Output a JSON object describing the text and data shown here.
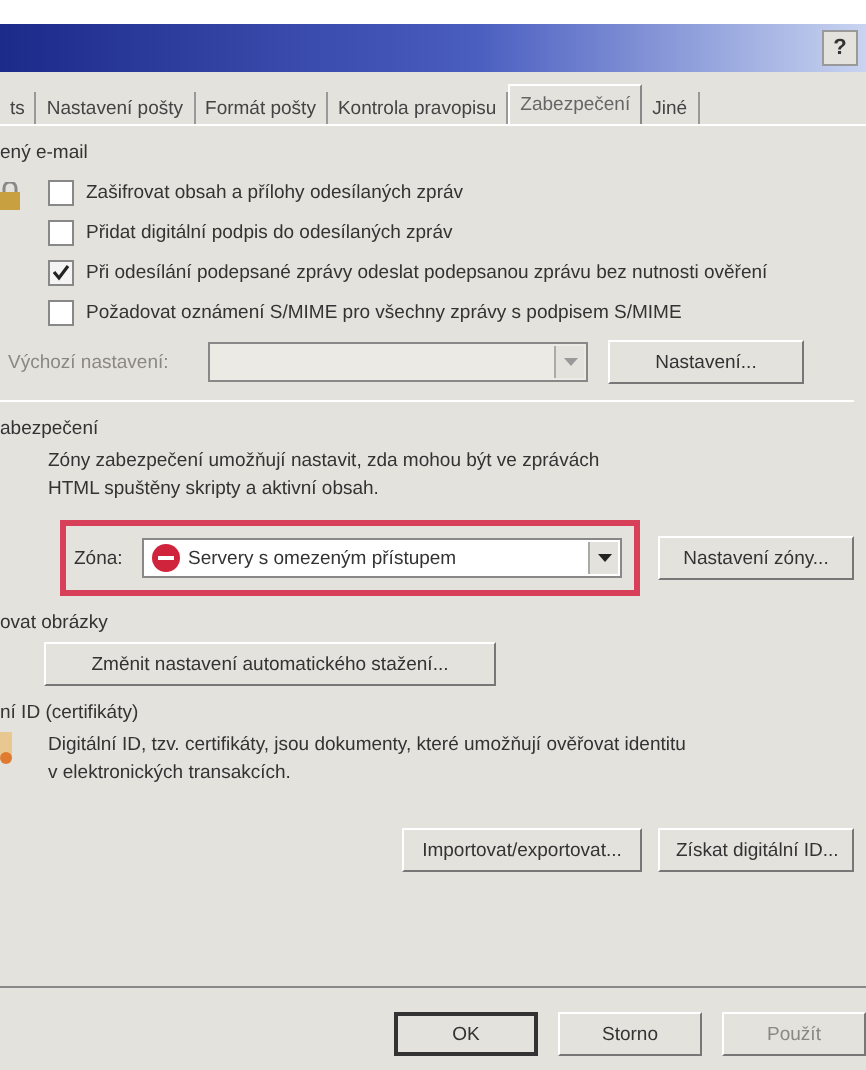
{
  "window": {
    "help_button": "?"
  },
  "tabs": [
    {
      "label": "ts",
      "selected": false
    },
    {
      "label": "Nastavení pošty",
      "selected": false
    },
    {
      "label": "Formát pošty",
      "selected": false
    },
    {
      "label": "Kontrola pravopisu",
      "selected": false
    },
    {
      "label": "Zabezpečení",
      "selected": true
    },
    {
      "label": "Jiné",
      "selected": false
    }
  ],
  "secure_mail": {
    "heading": "ený e-mail",
    "options": [
      {
        "label": "Zašifrovat obsah a přílohy odesílaných zpráv",
        "checked": false
      },
      {
        "label": "Přidat digitální podpis do odesílaných zpráv",
        "checked": false
      },
      {
        "label": "Při odesílání podepsané zprávy odeslat podepsanou zprávu bez nutnosti ověření",
        "checked": true
      },
      {
        "label": "Požadovat oznámení S/MIME pro všechny zprávy s podpisem S/MIME",
        "checked": false
      }
    ],
    "default_setting": {
      "label": "Výchozí nastavení:",
      "disabled": true
    },
    "settings_button": "Nastavení..."
  },
  "security_zones": {
    "heading": "abezpečení",
    "description": "Zóny zabezpečení umožňují nastavit, zda mohou být ve zprávách HTML spuštěny skripty a aktivní obsah.",
    "zone_label": "Zóna:",
    "zone_value": "Servery s omezeným přístupem",
    "zone_settings_button": "Nastavení zóny..."
  },
  "download_pictures": {
    "heading": "ovat obrázky",
    "button": "Změnit nastavení automatického stažení..."
  },
  "digital_ids": {
    "heading": "ní ID (certifikáty)",
    "description": "Digitální ID, tzv. certifikáty, jsou dokumenty, které umožňují ověřovat identitu v elektronických transakcích.",
    "buttons": [
      "Importovat/exportovat...",
      "Získat digitální ID..."
    ]
  },
  "dialog_buttons": [
    {
      "label": "OK",
      "disabled": false
    },
    {
      "label": "Storno",
      "disabled": false
    },
    {
      "label": "Použít",
      "disabled": true
    }
  ]
}
